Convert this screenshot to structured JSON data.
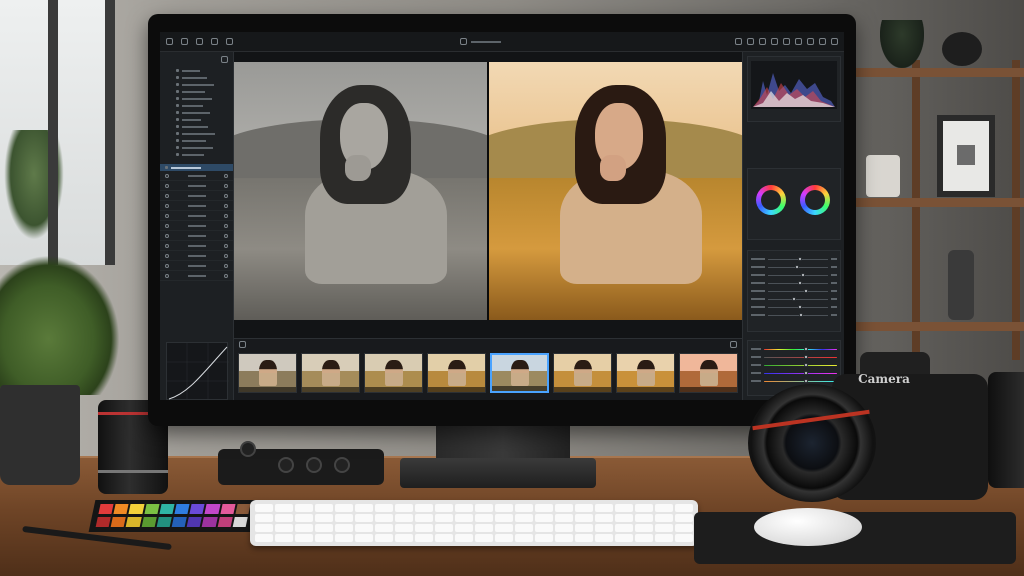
{
  "scene": {
    "camera_brand": "Camera"
  },
  "app": {
    "left_panel_title": "",
    "viewer_before_label": "",
    "viewer_after_label": "",
    "right_panel_titles": [
      "",
      "",
      "",
      ""
    ],
    "filmstrip_title": ""
  },
  "colors": {
    "accent": "#4aa3ff",
    "selection": "#2e4a66",
    "panel_bg": "#1d2023",
    "desk": "#6e4426"
  },
  "filmstrip": {
    "thumb_count": 8,
    "active_index": 4
  }
}
